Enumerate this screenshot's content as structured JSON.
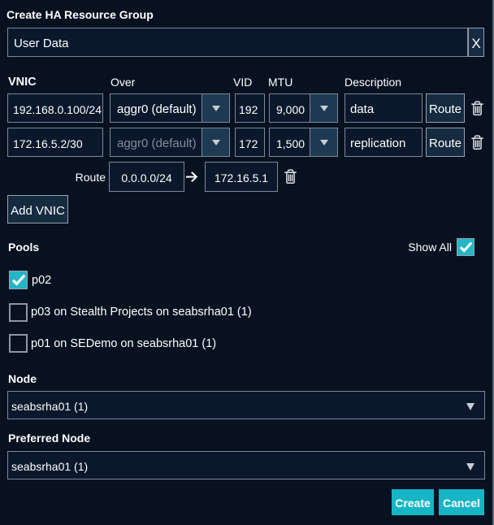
{
  "dialog": {
    "title": "Create HA Resource Group",
    "name_field": {
      "value": "User Data",
      "clear_label": "X"
    },
    "vnic_table": {
      "headers": {
        "vnic": "VNIC",
        "over": "Over",
        "vid": "VID",
        "mtu": "MTU",
        "description": "Description"
      },
      "rows": [
        {
          "vnic": "192.168.0.100/24",
          "over": "aggr0 (default)",
          "vid": "192",
          "mtu": "9,000",
          "description": "data",
          "route_label": "Route"
        },
        {
          "vnic": "172.16.5.2/30",
          "over": "aggr0 (default)",
          "vid": "172",
          "mtu": "1,500",
          "description": "replication",
          "route_label": "Route"
        }
      ],
      "route_row": {
        "label": "Route",
        "destination": "0.0.0.0/24",
        "gateway": "172.16.5.1"
      },
      "add_button_label": "Add VNIC"
    },
    "pools": {
      "label": "Pools",
      "show_all_label": "Show All",
      "show_all_checked": true,
      "items": [
        {
          "label": "p02",
          "checked": true
        },
        {
          "label": "p03 on Stealth Projects on seabsrha01 (1)",
          "checked": false
        },
        {
          "label": "p01 on SEDemo on seabsrha01 (1)",
          "checked": false
        }
      ]
    },
    "node": {
      "label": "Node",
      "value": "seabsrha01 (1)"
    },
    "preferred_node": {
      "label": "Preferred Node",
      "value": "seabsrha01 (1)"
    },
    "footer": {
      "create_label": "Create",
      "cancel_label": "Cancel"
    },
    "colors": {
      "accent": "#16b5c5",
      "background": "#071120",
      "panel": "#152b40",
      "border": "#7f8795"
    }
  }
}
